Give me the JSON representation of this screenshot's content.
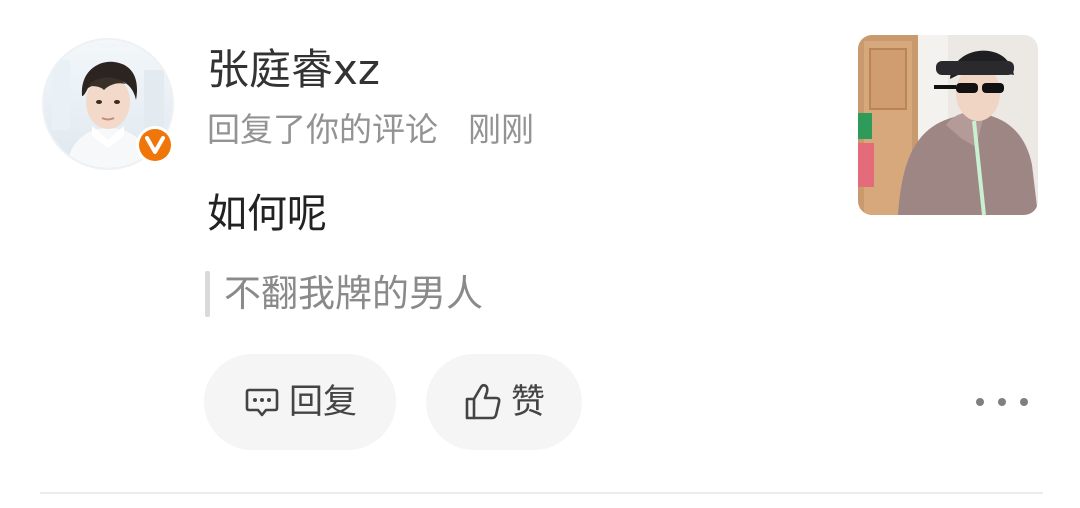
{
  "user": {
    "name": "张庭睿xz",
    "verified": true,
    "verified_badge_glyph": "v",
    "badge_color": "#f0760a"
  },
  "meta": {
    "action": "回复了你的评论",
    "time": "刚刚"
  },
  "comment": {
    "text": "如何呢"
  },
  "quote": {
    "text": "不翻我牌的男人"
  },
  "actions": {
    "reply": {
      "label": "回复",
      "icon": "comment-icon"
    },
    "like": {
      "label": "赞",
      "icon": "thumbs-up-icon"
    },
    "more": {
      "icon": "more-icon"
    }
  },
  "colors": {
    "text_primary": "#333333",
    "text_secondary": "#939393",
    "pill_background": "#f5f5f5",
    "divider": "#ececec"
  }
}
